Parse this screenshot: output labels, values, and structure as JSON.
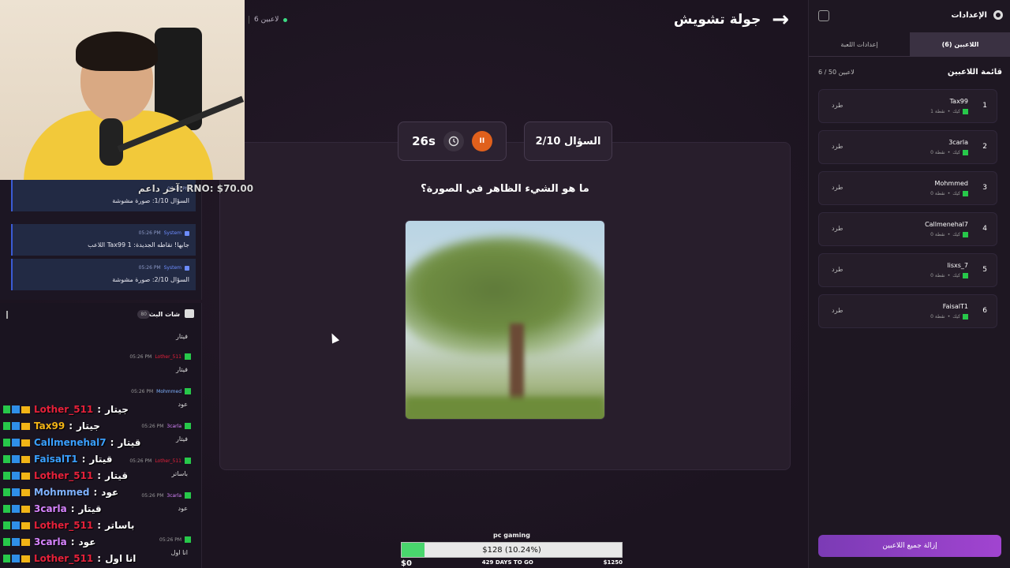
{
  "topbar": {
    "player_count": "6 لاعبين",
    "partial_label": "ال"
  },
  "round": {
    "title": "جولة تشويش",
    "arrow": "→"
  },
  "timer": {
    "value": "26s",
    "pause_symbol": "II"
  },
  "question": {
    "counter": "السؤال 2/10",
    "text": "ما هو الشيء الظاهر في الصورة؟"
  },
  "goal": {
    "title": "pc gaming",
    "label": "$128 (10.24%)",
    "progress": 0.1024,
    "start": "$0",
    "days": "429 DAYS TO GO",
    "end": "$1250"
  },
  "donation": "آخر داعم: RNO: $70.00",
  "system_feed": [
    {
      "time": "05:26 PM",
      "sender": "System",
      "message": "السؤال 1/10: صورة مشوشة"
    },
    {
      "time": "05:26 PM",
      "sender": "System",
      "message": "اللاعب Tax99 جابها! نقاطه الجديدة: 1"
    },
    {
      "time": "05:26 PM",
      "sender": "System",
      "message": "السؤال 2/10: صورة مشوشة"
    }
  ],
  "chat": {
    "title": "شات البث",
    "count": "80",
    "messages": [
      {
        "user": "",
        "time": "",
        "text": "فيتار"
      },
      {
        "user": "Lother_511",
        "time": "05:26 PM",
        "text": "فيتار"
      },
      {
        "user": "Mohmmed",
        "time": "05:26 PM",
        "text": "عود"
      },
      {
        "user": "3carla",
        "time": "05:26 PM",
        "text": "فيتار"
      },
      {
        "user": "Lother_511",
        "time": "05:26 PM",
        "text": "باساتر"
      },
      {
        "user": "3carla",
        "time": "05:26 PM",
        "text": "عود"
      },
      {
        "user": "",
        "time": "05:26 PM",
        "text": "انا اول"
      }
    ]
  },
  "overlay_chat": [
    {
      "user": "Lother_511",
      "text": "جيتار",
      "color": "#e5213a"
    },
    {
      "user": "Tax99",
      "text": "جيتار",
      "color": "#f2b416"
    },
    {
      "user": "Callmenehal7",
      "text": "قيتار",
      "color": "#3aa0ff"
    },
    {
      "user": "FaisalT1",
      "text": "قيتار",
      "color": "#3aa0ff"
    },
    {
      "user": "Lother_511",
      "text": "قيتار",
      "color": "#e5213a"
    },
    {
      "user": "Mohmmed",
      "text": "عود",
      "color": "#7fb2ff"
    },
    {
      "user": "3carla",
      "text": "قيتار",
      "color": "#d884ff"
    },
    {
      "user": "Lother_511",
      "text": "باساتر",
      "color": "#e5213a"
    },
    {
      "user": "3carla",
      "text": "عود",
      "color": "#d884ff"
    },
    {
      "user": "Lother_511",
      "text": "انا اول",
      "color": "#e5213a"
    }
  ],
  "sidebar": {
    "title": "الإعدادات",
    "tabs": {
      "players": "اللاعبين (6)",
      "game": "إعدادات اللعبة"
    },
    "list_title": "قائمة اللاعبين",
    "list_count": "6 / 50 لاعبين",
    "kick_label": "طرد",
    "platform": "كيك",
    "players": [
      {
        "rank": "1",
        "name": "Tax99",
        "points": "1 نقطة"
      },
      {
        "rank": "2",
        "name": "3carla",
        "points": "0 نقطة"
      },
      {
        "rank": "3",
        "name": "Mohmmed",
        "points": "0 نقطة"
      },
      {
        "rank": "4",
        "name": "Callmenehal7",
        "points": "0 نقطة"
      },
      {
        "rank": "5",
        "name": "lisxs_7",
        "points": "0 نقطة"
      },
      {
        "rank": "6",
        "name": "FaisalT1",
        "points": "0 نقطة"
      }
    ],
    "remove_all": "إزالة جميع اللاعبين"
  }
}
